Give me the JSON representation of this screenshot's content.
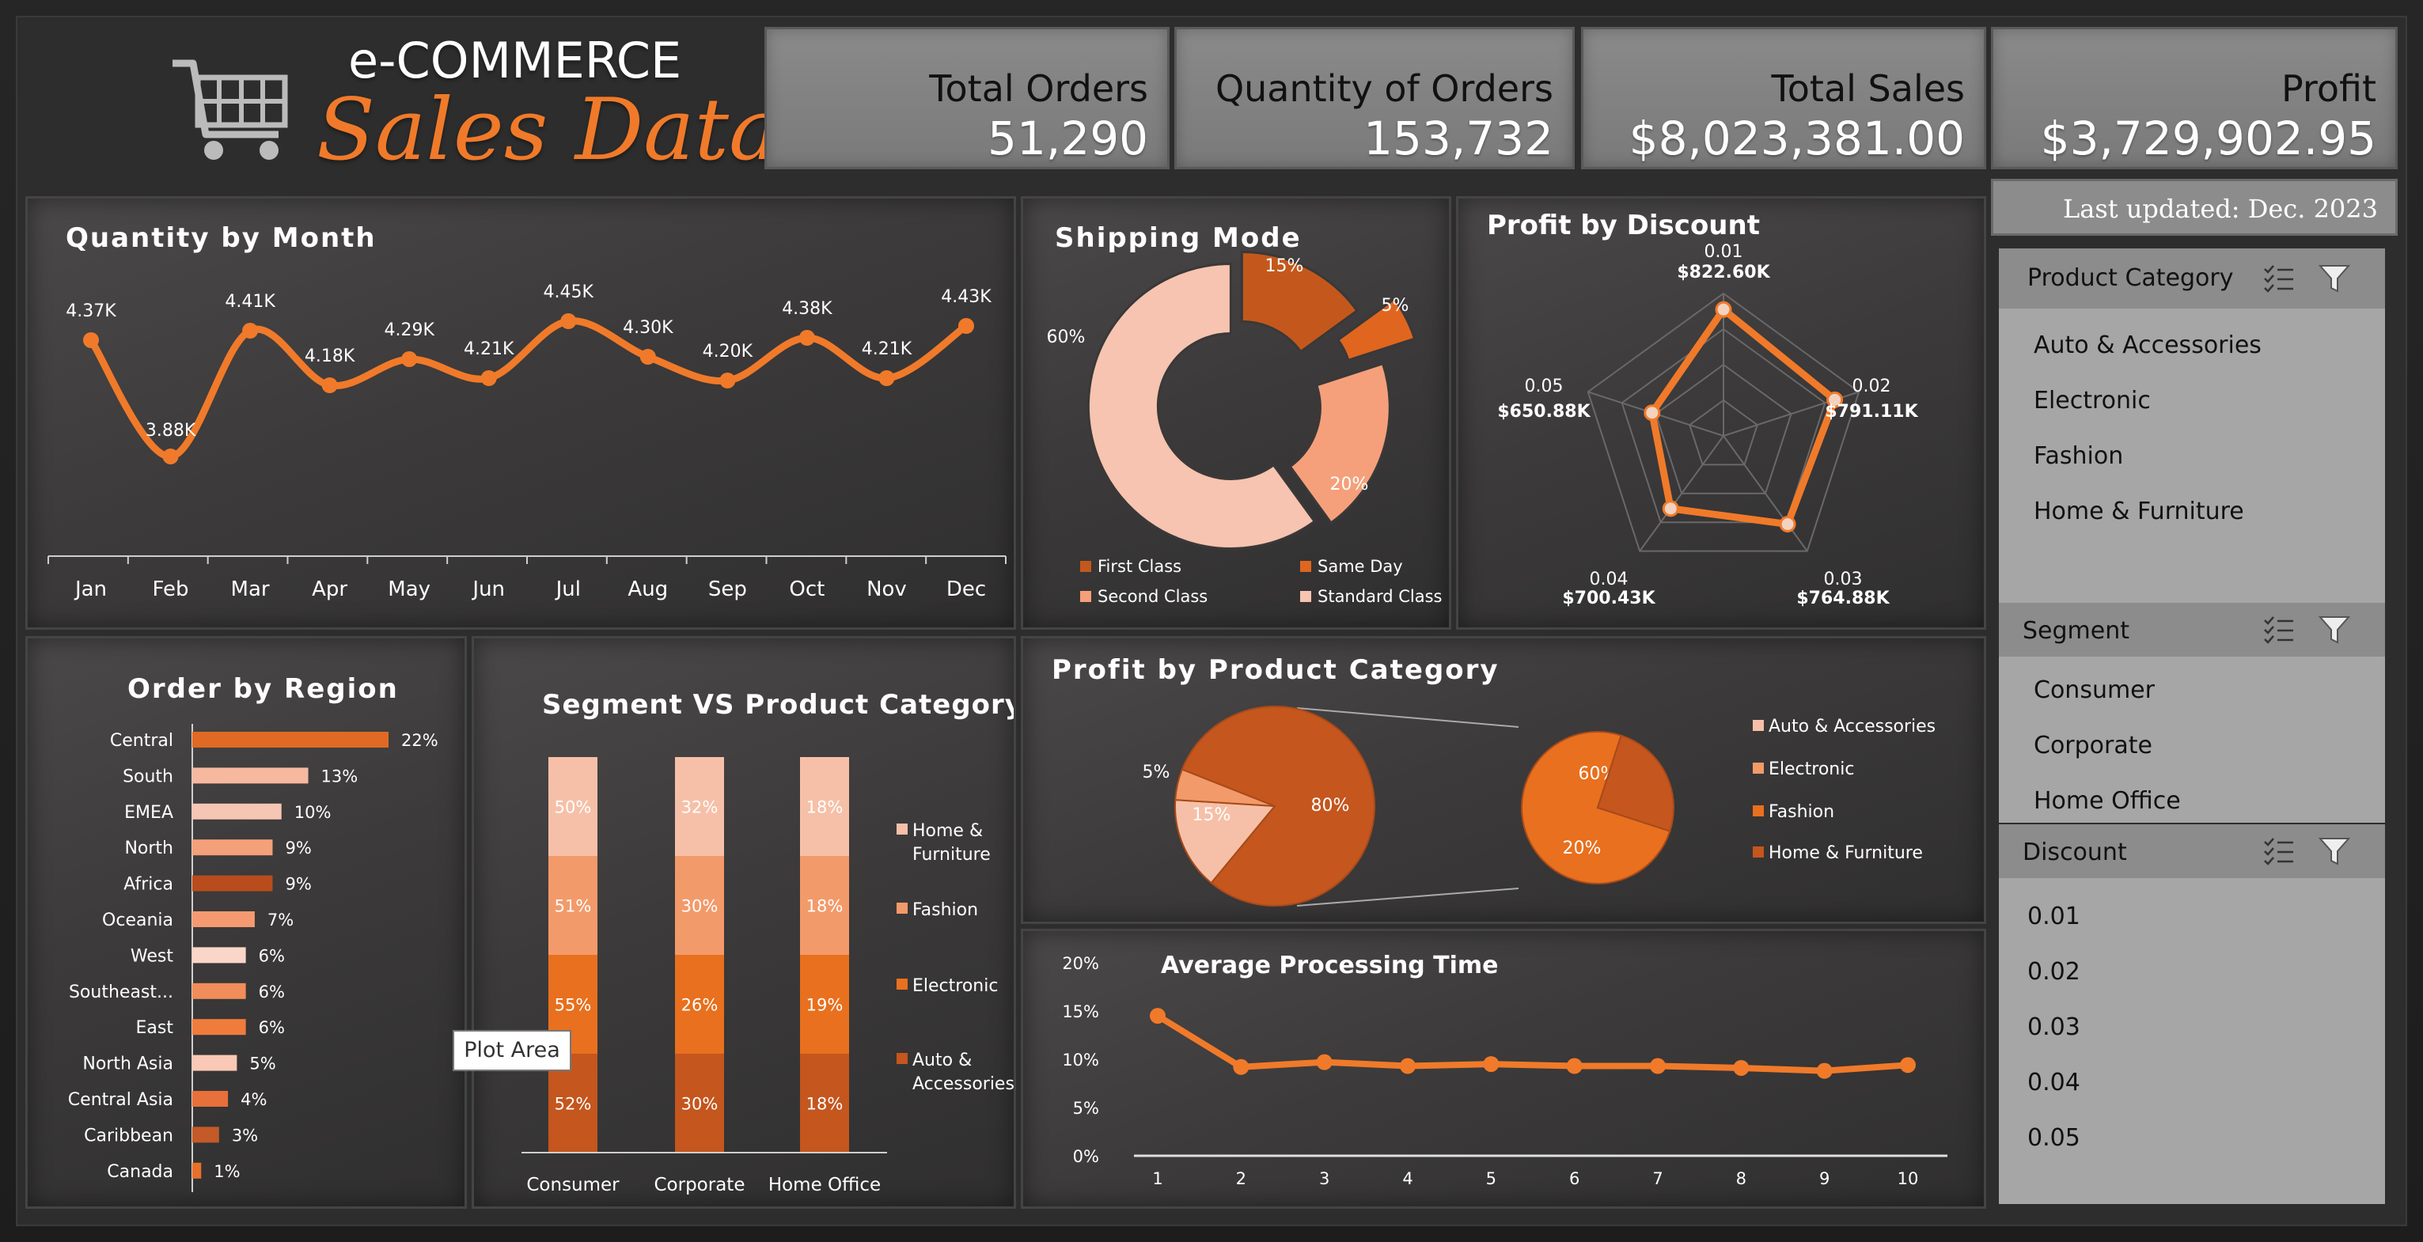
{
  "logo": {
    "line1": "e-COMMERCE",
    "line2": "Sales Data"
  },
  "kpis": [
    {
      "label": "Total Orders",
      "value": "51,290"
    },
    {
      "label": "Quantity of Orders",
      "value": "153,732"
    },
    {
      "label": "Total Sales",
      "value": "$8,023,381.00"
    },
    {
      "label": "Profit",
      "value": "$3,729,902.95"
    }
  ],
  "last_updated": "Last updated: Dec. 2023",
  "colors": {
    "accent": "#f07a2a",
    "panel": "#3f3d3d",
    "slicer": "#a6a6a6",
    "slicer_head": "#8c8c8c"
  },
  "slicers": [
    {
      "title": "Product Category",
      "items": [
        "Auto & Accessories",
        "Electronic",
        "Fashion",
        "Home & Furniture"
      ]
    },
    {
      "title": "Segment",
      "items": [
        "Consumer",
        "Corporate",
        "Home Office"
      ]
    },
    {
      "title": "Discount",
      "items": [
        "0.01",
        "0.02",
        "0.03",
        "0.04",
        "0.05"
      ]
    }
  ],
  "slicer_icons": [
    "multi-select-icon",
    "clear-filter-icon"
  ],
  "tooltip": "Plot Area",
  "chart_data": [
    {
      "type": "line",
      "title": "Quantity by Month",
      "categories": [
        "Jan",
        "Feb",
        "Mar",
        "Apr",
        "May",
        "Jun",
        "Jul",
        "Aug",
        "Sep",
        "Oct",
        "Nov",
        "Dec"
      ],
      "values": [
        4370,
        3880,
        4410,
        4180,
        4290,
        4210,
        4450,
        4300,
        4200,
        4380,
        4210,
        4430
      ],
      "labels": [
        "4.37K",
        "3.88K",
        "4.41K",
        "4.18K",
        "4.29K",
        "4.21K",
        "4.45K",
        "4.30K",
        "4.20K",
        "4.38K",
        "4.21K",
        "4.43K"
      ],
      "ylim": [
        3700,
        4600
      ]
    },
    {
      "type": "pie",
      "title": "Shipping Mode",
      "categories": [
        "First Class",
        "Same Day",
        "Second Class",
        "Standard Class"
      ],
      "values": [
        15,
        5,
        20,
        60
      ],
      "labels": [
        "15%",
        "5%",
        "20%",
        "60%"
      ],
      "colors": [
        "#c4581c",
        "#e0651f",
        "#f5a07a",
        "#f6c4b0"
      ]
    },
    {
      "type": "radar",
      "title": "Profit by Discount",
      "categories": [
        "0.01",
        "0.02",
        "0.03",
        "0.04",
        "0.05"
      ],
      "values": [
        822.6,
        791.11,
        764.88,
        700.43,
        650.88
      ],
      "labels": [
        "$822.60K",
        "$791.11K",
        "$764.88K",
        "$700.43K",
        "$650.88K"
      ]
    },
    {
      "type": "bar",
      "title": "Order by Region",
      "categories": [
        "Central",
        "South",
        "EMEA",
        "North",
        "Africa",
        "Oceania",
        "West",
        "Southeast...",
        "East",
        "North Asia",
        "Central Asia",
        "Caribbean",
        "Canada"
      ],
      "values": [
        22,
        13,
        10,
        9,
        9,
        7,
        6,
        6,
        6,
        5,
        4,
        3,
        1
      ],
      "labels": [
        "22%",
        "13%",
        "10%",
        "9%",
        "9%",
        "7%",
        "6%",
        "6%",
        "6%",
        "5%",
        "4%",
        "3%",
        "1%"
      ],
      "colors": [
        "#e06a24",
        "#f6b9a0",
        "#f6c6b4",
        "#f4a07a",
        "#b84c1c",
        "#f59a70",
        "#f9d6c8",
        "#f08d5a",
        "#f07c3c",
        "#f9c9b5",
        "#e8703a",
        "#c35a28",
        "#e8702a"
      ]
    },
    {
      "type": "bar",
      "title": "Segment VS Product Category",
      "categories": [
        "Consumer",
        "Corporate",
        "Home Office"
      ],
      "series": [
        {
          "name": "Auto & Accessories",
          "values": [
            52,
            30,
            18
          ],
          "labels": [
            "52%",
            "30%",
            "18%"
          ],
          "color": "#c4561e"
        },
        {
          "name": "Electronic",
          "values": [
            55,
            26,
            19
          ],
          "labels": [
            "55%",
            "26%",
            "19%"
          ],
          "color": "#e8701e"
        },
        {
          "name": "Fashion",
          "values": [
            51,
            30,
            18
          ],
          "labels": [
            "51%",
            "30%",
            "18%"
          ],
          "color": "#f39a6a"
        },
        {
          "name": "Home & Furniture",
          "values": [
            50,
            32,
            18
          ],
          "labels": [
            "50%",
            "32%",
            "18%"
          ],
          "color": "#f6c0a8"
        }
      ],
      "legend": [
        "Home & Furniture",
        "Fashion",
        "Electronic",
        "Auto & Accessories"
      ]
    },
    {
      "type": "pie",
      "title": "Profit by Product Category",
      "categories": [
        "Auto & Accessories",
        "Electronic",
        "Fashion",
        "Home & Furniture"
      ],
      "main": {
        "values": [
          15,
          5,
          80
        ],
        "labels": [
          "15%",
          "5%",
          "80%"
        ]
      },
      "secondary": {
        "values": [
          60,
          20
        ],
        "labels": [
          "60%",
          "20%"
        ]
      },
      "colors": [
        "#f6c0a8",
        "#f39a6a",
        "#e8701e",
        "#c4561e"
      ]
    },
    {
      "type": "line",
      "title": "Average Processing Time",
      "categories": [
        "1",
        "2",
        "3",
        "4",
        "5",
        "6",
        "7",
        "8",
        "9",
        "10"
      ],
      "values": [
        14.5,
        9.2,
        9.7,
        9.3,
        9.5,
        9.3,
        9.3,
        9.1,
        8.8,
        9.4
      ],
      "yticks": [
        "0%",
        "5%",
        "10%",
        "15%",
        "20%"
      ],
      "ylim": [
        0,
        20
      ]
    }
  ]
}
